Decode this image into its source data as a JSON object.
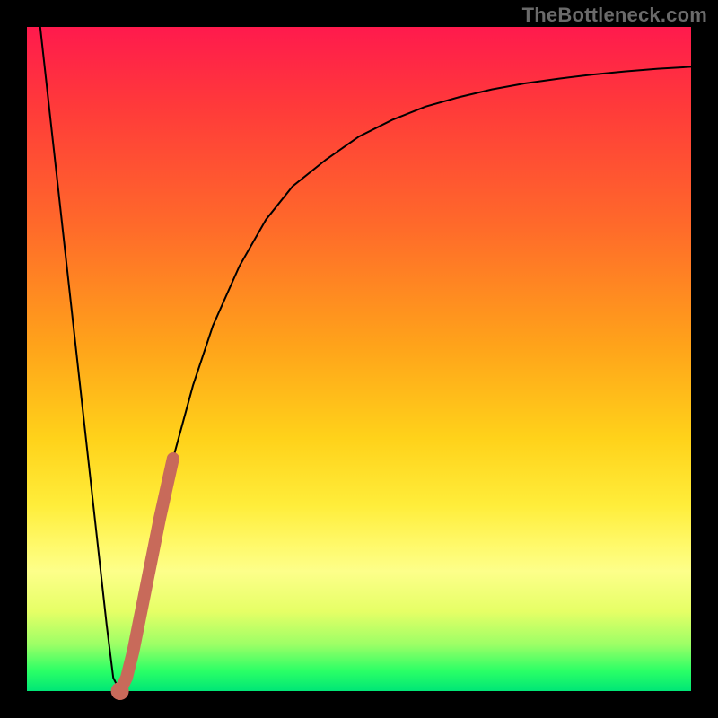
{
  "watermark": {
    "text": "TheBottleneck.com"
  },
  "colors": {
    "frame": "#000000",
    "curve": "#000000",
    "highlight": "#c86a5a",
    "gradient_top": "#ff1a4d",
    "gradient_bottom": "#00e676"
  },
  "chart_data": {
    "type": "line",
    "title": "",
    "xlabel": "",
    "ylabel": "",
    "xlim": [
      0,
      100
    ],
    "ylim": [
      0,
      100
    ],
    "grid": false,
    "series": [
      {
        "name": "bottleneck-curve",
        "x": [
          2,
          4,
          6,
          8,
          10,
          12,
          13,
          14,
          15,
          16,
          18,
          20,
          22,
          25,
          28,
          32,
          36,
          40,
          45,
          50,
          55,
          60,
          65,
          70,
          75,
          80,
          85,
          90,
          95,
          100
        ],
        "y": [
          100,
          82,
          64,
          46,
          28,
          10,
          2,
          0,
          2,
          6,
          16,
          26,
          35,
          46,
          55,
          64,
          71,
          76,
          80,
          83.5,
          86,
          88,
          89.4,
          90.6,
          91.5,
          92.2,
          92.8,
          93.3,
          93.7,
          94
        ]
      }
    ],
    "highlight_segment": {
      "series": "bottleneck-curve",
      "x_start": 14,
      "x_end": 22,
      "note": "thick muted-red overlay on right rising branch near minimum"
    },
    "minimum_point": {
      "x": 14,
      "y": 0
    }
  }
}
